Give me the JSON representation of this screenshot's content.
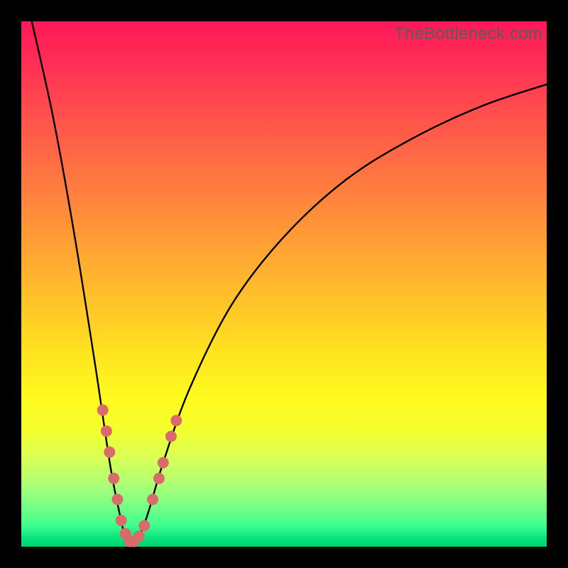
{
  "watermark": "TheBottleneck.com",
  "colors": {
    "frame": "#000000",
    "curve": "#000000",
    "marker": "#d96b6b",
    "gradient_top": "#ff1858",
    "gradient_bottom": "#00d268"
  },
  "chart_data": {
    "type": "line",
    "title": "",
    "xlabel": "",
    "ylabel": "",
    "xlim": [
      0,
      100
    ],
    "ylim": [
      0,
      100
    ],
    "grid": false,
    "curve": {
      "description": "V-shaped bottleneck curve; y ~ 100*|x - 21|/k with minimum near x=21",
      "minimum_x": 21,
      "points": [
        {
          "x": 2,
          "y": 100
        },
        {
          "x": 6,
          "y": 82
        },
        {
          "x": 10,
          "y": 60
        },
        {
          "x": 14,
          "y": 35
        },
        {
          "x": 17,
          "y": 15
        },
        {
          "x": 19,
          "y": 5
        },
        {
          "x": 20,
          "y": 1
        },
        {
          "x": 21,
          "y": 0
        },
        {
          "x": 22,
          "y": 1
        },
        {
          "x": 24,
          "y": 6
        },
        {
          "x": 27,
          "y": 16
        },
        {
          "x": 32,
          "y": 30
        },
        {
          "x": 40,
          "y": 46
        },
        {
          "x": 50,
          "y": 59
        },
        {
          "x": 62,
          "y": 70
        },
        {
          "x": 75,
          "y": 78
        },
        {
          "x": 88,
          "y": 84
        },
        {
          "x": 100,
          "y": 88
        }
      ]
    },
    "series": [
      {
        "name": "markers",
        "points": [
          {
            "x": 15.5,
            "y": 26
          },
          {
            "x": 16.2,
            "y": 22
          },
          {
            "x": 16.8,
            "y": 18
          },
          {
            "x": 17.6,
            "y": 13
          },
          {
            "x": 18.3,
            "y": 9
          },
          {
            "x": 19.0,
            "y": 5
          },
          {
            "x": 19.8,
            "y": 2.5
          },
          {
            "x": 20.6,
            "y": 1
          },
          {
            "x": 21.4,
            "y": 1
          },
          {
            "x": 22.4,
            "y": 2
          },
          {
            "x": 23.4,
            "y": 4
          },
          {
            "x": 25.0,
            "y": 9
          },
          {
            "x": 26.2,
            "y": 13
          },
          {
            "x": 27.0,
            "y": 16
          },
          {
            "x": 28.5,
            "y": 21
          },
          {
            "x": 29.5,
            "y": 24
          }
        ]
      }
    ]
  }
}
